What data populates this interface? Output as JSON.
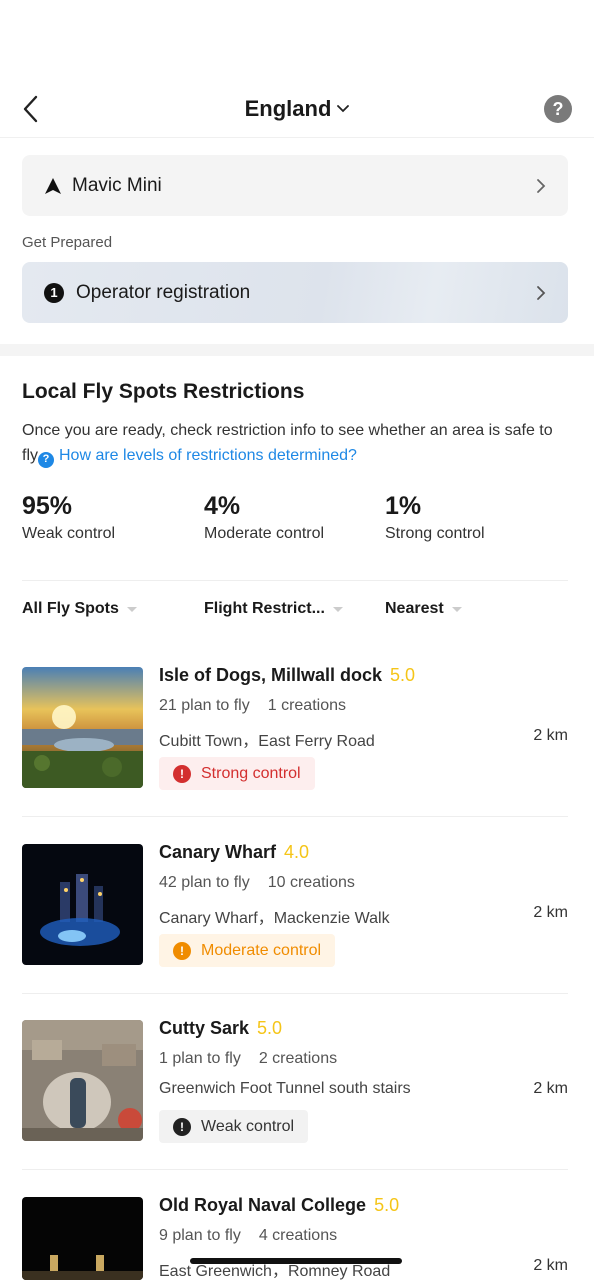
{
  "nav": {
    "title": "England",
    "help": "?"
  },
  "drone": {
    "name": "Mavic Mini"
  },
  "prepare": {
    "title": "Get Prepared",
    "step_number": "1",
    "step_label": "Operator registration"
  },
  "restrictions": {
    "title": "Local Fly Spots Restrictions",
    "desc": "Once you are ready, check restriction info to see whether an area is safe to fly",
    "help_link": "How are levels of restrictions determined?",
    "stats": [
      {
        "value": "95%",
        "label": "Weak control"
      },
      {
        "value": "4%",
        "label": "Moderate control"
      },
      {
        "value": "1%",
        "label": "Strong control"
      }
    ]
  },
  "filters": [
    "All Fly Spots",
    "Flight Restrict...",
    "Nearest"
  ],
  "spots": [
    {
      "name": "Isle of Dogs, Millwall dock",
      "rating": "5.0",
      "plans": "21 plan to fly",
      "creations": "1 creations",
      "address": "Cubitt Town，East Ferry Road",
      "distance": "2 km",
      "control": "Strong control",
      "level": "strong"
    },
    {
      "name": "Canary Wharf",
      "rating": "4.0",
      "plans": "42 plan to fly",
      "creations": "10 creations",
      "address": "Canary Wharf，Mackenzie Walk",
      "distance": "2 km",
      "control": "Moderate control",
      "level": "moderate"
    },
    {
      "name": "Cutty Sark",
      "rating": "5.0",
      "plans": "1 plan to fly",
      "creations": "2 creations",
      "address": "Greenwich Foot Tunnel south stairs",
      "distance": "2 km",
      "control": "Weak control",
      "level": "weak"
    },
    {
      "name": "Old Royal Naval College",
      "rating": "5.0",
      "plans": "9 plan to fly",
      "creations": "4 creations",
      "address": "East Greenwich，Romney Road",
      "distance": "2 km"
    }
  ],
  "colors": {
    "link": "#1e88e5",
    "rating": "#f5c518",
    "strong": "#d32f2f",
    "moderate": "#f08c00"
  }
}
